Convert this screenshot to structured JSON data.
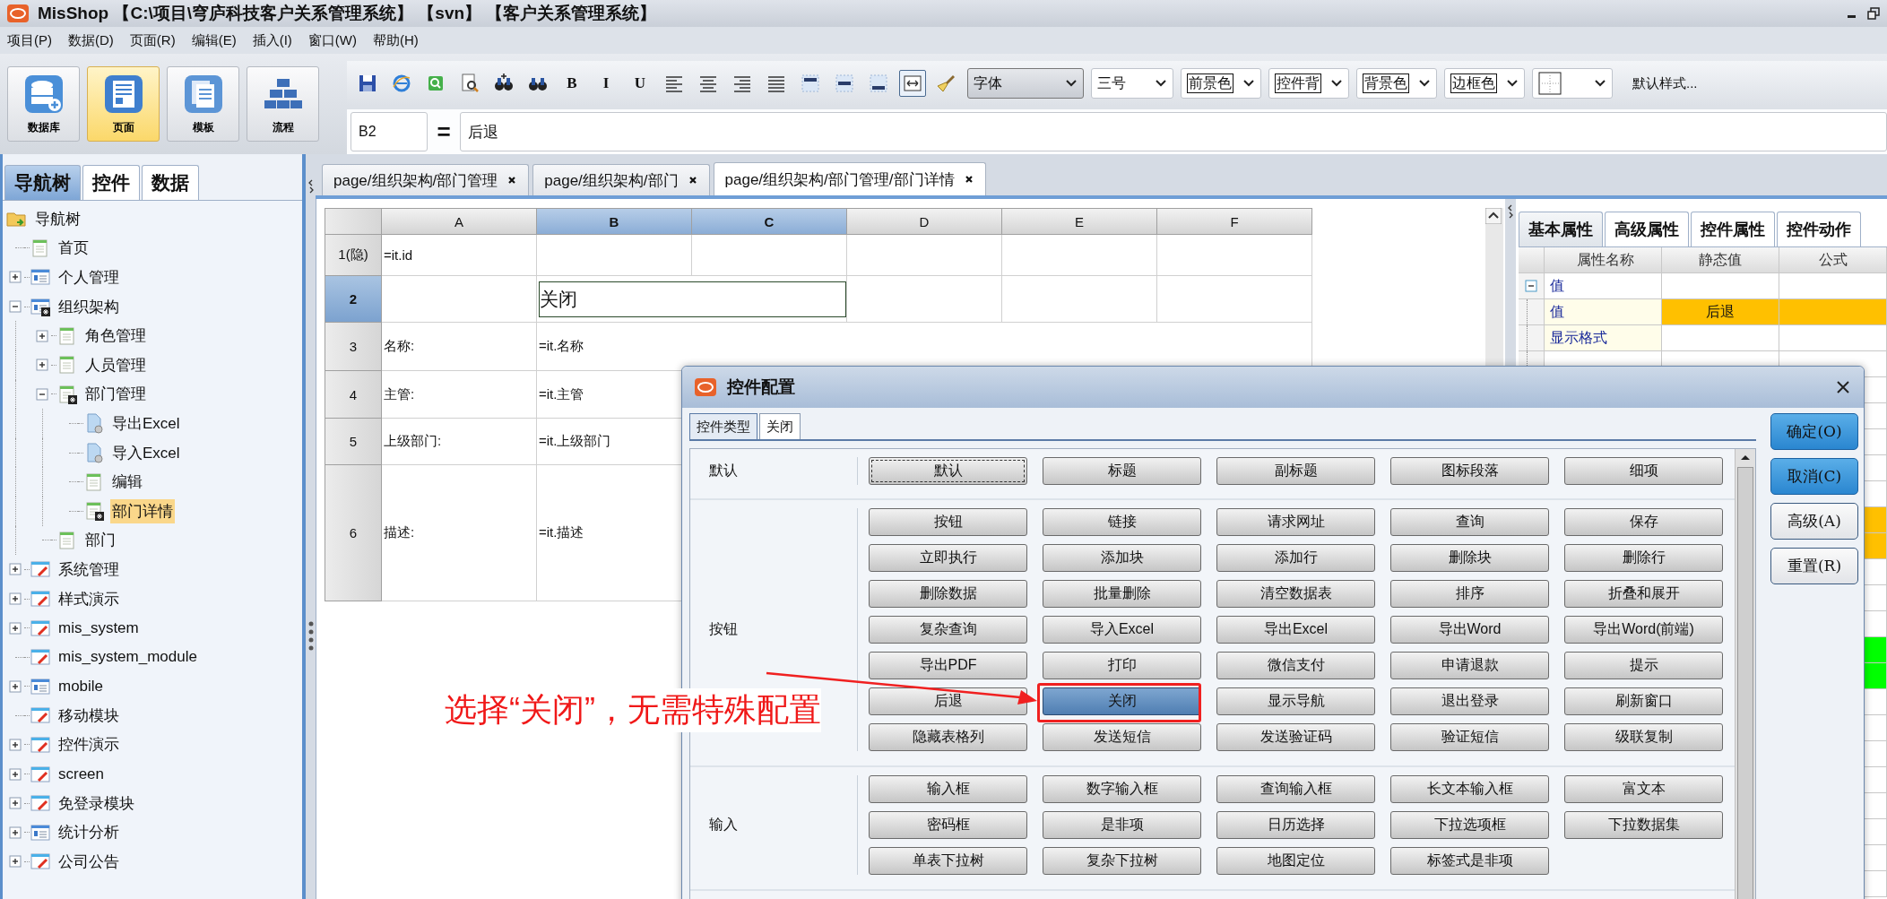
{
  "window": {
    "title": "MisShop 【C:\\项目\\穹庐科技客户关系管理系统】 【svn】 【客户关系管理系统】"
  },
  "menu": [
    "项目(P)",
    "数据(D)",
    "页面(R)",
    "编辑(E)",
    "插入(I)",
    "窗口(W)",
    "帮助(H)"
  ],
  "ribbon": [
    {
      "label": "数据库",
      "kind": "database",
      "selected": false
    },
    {
      "label": "页面",
      "kind": "page",
      "selected": true
    },
    {
      "label": "模板",
      "kind": "template",
      "selected": false
    },
    {
      "label": "流程",
      "kind": "flow",
      "selected": false
    }
  ],
  "toolbar": {
    "tools": [
      {
        "kind": "save",
        "selected": false
      },
      {
        "kind": "browser",
        "selected": false
      },
      {
        "kind": "find",
        "selected": false
      },
      {
        "kind": "preview",
        "selected": false
      },
      {
        "kind": "binoculars_plus",
        "selected": false
      },
      {
        "kind": "binoculars",
        "selected": false
      },
      {
        "kind": "text",
        "label": "B",
        "selected": false
      },
      {
        "kind": "text",
        "label": "I",
        "selected": false
      },
      {
        "kind": "text",
        "label": "U",
        "selected": false
      },
      {
        "kind": "align_left",
        "selected": false
      },
      {
        "kind": "align_center",
        "selected": false
      },
      {
        "kind": "align_right",
        "selected": false
      },
      {
        "kind": "justify",
        "selected": false
      },
      {
        "kind": "valign_top",
        "selected": false
      },
      {
        "kind": "valign_middle",
        "selected": false
      },
      {
        "kind": "valign_bottom",
        "selected": false
      },
      {
        "kind": "merge",
        "selected": true
      },
      {
        "kind": "brush",
        "selected": false
      }
    ],
    "selects": [
      {
        "kind": "plain",
        "value": "字体"
      },
      {
        "kind": "plain",
        "value": "三号"
      },
      {
        "kind": "framed",
        "value": "前景色"
      },
      {
        "kind": "framed",
        "value": "控件背"
      },
      {
        "kind": "framed",
        "value": "背景色"
      },
      {
        "kind": "framed",
        "value": "边框色"
      },
      {
        "kind": "border"
      }
    ],
    "style_link": "默认样式..."
  },
  "formula_bar": {
    "cell": "B2",
    "sign": "=",
    "value": "后退"
  },
  "doc_tabs": [
    {
      "label": "page/组织架构/部门管理",
      "selected": false
    },
    {
      "label": "page/组织架构/部门",
      "selected": false
    },
    {
      "label": "page/组织架构/部门管理/部门详情",
      "selected": true
    }
  ],
  "left_panel": {
    "tabs": [
      {
        "label": "导航树",
        "selected": true
      },
      {
        "label": "控件",
        "selected": false
      },
      {
        "label": "数据",
        "selected": false
      }
    ],
    "tree": {
      "label": "导航树",
      "kind": "folder",
      "selected": false,
      "children": [
        {
          "label": "首页",
          "kind": "page",
          "selected": false
        },
        {
          "label": "个人管理",
          "kind": "list",
          "selected": false,
          "expanded": false
        },
        {
          "label": "组织架构",
          "kind": "list_marked",
          "selected": false,
          "expanded": true,
          "children": [
            {
              "label": "角色管理",
              "kind": "page",
              "selected": false,
              "expanded": false
            },
            {
              "label": "人员管理",
              "kind": "page",
              "selected": false,
              "expanded": false
            },
            {
              "label": "部门管理",
              "kind": "page_marked",
              "selected": false,
              "expanded": true,
              "children": [
                {
                  "label": "导出Excel",
                  "kind": "action",
                  "selected": false
                },
                {
                  "label": "导入Excel",
                  "kind": "action",
                  "selected": false
                },
                {
                  "label": "编辑",
                  "kind": "page",
                  "selected": false
                },
                {
                  "label": "部门详情",
                  "kind": "page_marked",
                  "selected": true
                }
              ]
            },
            {
              "label": "部门",
              "kind": "page",
              "selected": false
            }
          ]
        },
        {
          "label": "系统管理",
          "kind": "module",
          "selected": false,
          "expanded": false
        },
        {
          "label": "样式演示",
          "kind": "module",
          "selected": false,
          "expanded": false
        },
        {
          "label": "mis_system",
          "kind": "module",
          "selected": false,
          "expanded": false
        },
        {
          "label": "mis_system_module",
          "kind": "module",
          "selected": false
        },
        {
          "label": "mobile",
          "kind": "list",
          "selected": false,
          "expanded": false
        },
        {
          "label": "移动模块",
          "kind": "module",
          "selected": false
        },
        {
          "label": "控件演示",
          "kind": "module",
          "selected": false,
          "expanded": false
        },
        {
          "label": "screen",
          "kind": "module",
          "selected": false,
          "expanded": false
        },
        {
          "label": "免登录模块",
          "kind": "module",
          "selected": false,
          "expanded": false
        },
        {
          "label": "统计分析",
          "kind": "list",
          "selected": false,
          "expanded": false
        },
        {
          "label": "公司公告",
          "kind": "module",
          "selected": false,
          "expanded": false
        }
      ]
    }
  },
  "sheet": {
    "columns": [
      {
        "label": "A",
        "selected": false
      },
      {
        "label": "B",
        "selected": true
      },
      {
        "label": "C",
        "selected": true
      },
      {
        "label": "D",
        "selected": false
      },
      {
        "label": "E",
        "selected": false
      },
      {
        "label": "F",
        "selected": false
      }
    ],
    "rows": [
      {
        "header": "1(隐)",
        "selected": false,
        "kind": "plain",
        "cells": [
          "=it.id"
        ]
      },
      {
        "header": "2",
        "selected": true,
        "kind": "merged_bc",
        "cells": [
          "",
          "关闭"
        ]
      },
      {
        "header": "3",
        "selected": false,
        "kind": "merged_bf",
        "cells": [
          "名称:",
          "=it.名称"
        ]
      },
      {
        "header": "4",
        "selected": false,
        "kind": "merged_bf",
        "cells": [
          "主管:",
          "=it.主管"
        ]
      },
      {
        "header": "5",
        "selected": false,
        "kind": "merged_bf",
        "cells": [
          "上级部门:",
          "=it.上级部门"
        ]
      },
      {
        "header": "6",
        "selected": false,
        "kind": "merged_bf",
        "cells": [
          "描述:",
          "=it.描述"
        ]
      }
    ]
  },
  "properties": {
    "tabs": [
      {
        "label": "基本属性",
        "selected": true
      },
      {
        "label": "高级属性",
        "selected": false
      },
      {
        "label": "控件属性",
        "selected": false
      },
      {
        "label": "控件动作",
        "selected": false
      }
    ],
    "columns": [
      "属性名称",
      "静态值",
      "公式"
    ],
    "rows": [
      {
        "kind": "group",
        "name": "值",
        "expanded": true
      },
      {
        "kind": "item",
        "name": "值",
        "value": "后退",
        "color": "#ffc000"
      },
      {
        "kind": "item",
        "name": "显示格式"
      },
      {
        "kind": "item"
      },
      {
        "kind": "item"
      },
      {
        "kind": "item"
      },
      {
        "kind": "item"
      },
      {
        "kind": "item"
      },
      {
        "kind": "item"
      },
      {
        "kind": "item",
        "color": "#ffc000"
      },
      {
        "kind": "item",
        "color": "#ffc000"
      },
      {
        "kind": "item"
      },
      {
        "kind": "item"
      },
      {
        "kind": "item"
      },
      {
        "kind": "item",
        "color": "#00ff00"
      },
      {
        "kind": "item",
        "color": "#00ff00"
      },
      {
        "kind": "item"
      },
      {
        "kind": "item"
      },
      {
        "kind": "item"
      },
      {
        "kind": "item"
      },
      {
        "kind": "item"
      },
      {
        "kind": "item"
      },
      {
        "kind": "item"
      },
      {
        "kind": "item"
      }
    ]
  },
  "dialog": {
    "title": "控件配置",
    "tabs": [
      {
        "label": "控件类型",
        "selected": true
      },
      {
        "label": "关闭",
        "selected": false
      }
    ],
    "sections": [
      {
        "label": "默认",
        "buttons": [
          {
            "label": "默认",
            "selected": false,
            "focused": true
          },
          {
            "label": "标题",
            "selected": false,
            "focused": false
          },
          {
            "label": "副标题",
            "selected": false,
            "focused": false
          },
          {
            "label": "图标段落",
            "selected": false,
            "focused": false
          },
          {
            "label": "细项",
            "selected": false,
            "focused": false
          }
        ]
      },
      {
        "label": "按钮",
        "buttons": [
          {
            "label": "按钮",
            "selected": false,
            "focused": false
          },
          {
            "label": "链接",
            "selected": false,
            "focused": false
          },
          {
            "label": "请求网址",
            "selected": false,
            "focused": false
          },
          {
            "label": "查询",
            "selected": false,
            "focused": false
          },
          {
            "label": "保存",
            "selected": false,
            "focused": false
          },
          {
            "label": "立即执行",
            "selected": false,
            "focused": false
          },
          {
            "label": "添加块",
            "selected": false,
            "focused": false
          },
          {
            "label": "添加行",
            "selected": false,
            "focused": false
          },
          {
            "label": "删除块",
            "selected": false,
            "focused": false
          },
          {
            "label": "删除行",
            "selected": false,
            "focused": false
          },
          {
            "label": "删除数据",
            "selected": false,
            "focused": false
          },
          {
            "label": "批量删除",
            "selected": false,
            "focused": false
          },
          {
            "label": "清空数据表",
            "selected": false,
            "focused": false
          },
          {
            "label": "排序",
            "selected": false,
            "focused": false
          },
          {
            "label": "折叠和展开",
            "selected": false,
            "focused": false
          },
          {
            "label": "复杂查询",
            "selected": false,
            "focused": false
          },
          {
            "label": "导入Excel",
            "selected": false,
            "focused": false
          },
          {
            "label": "导出Excel",
            "selected": false,
            "focused": false
          },
          {
            "label": "导出Word",
            "selected": false,
            "focused": false
          },
          {
            "label": "导出Word(前端)",
            "selected": false,
            "focused": false
          },
          {
            "label": "导出PDF",
            "selected": false,
            "focused": false
          },
          {
            "label": "打印",
            "selected": false,
            "focused": false
          },
          {
            "label": "微信支付",
            "selected": false,
            "focused": false
          },
          {
            "label": "申请退款",
            "selected": false,
            "focused": false
          },
          {
            "label": "提示",
            "selected": false,
            "focused": false
          },
          {
            "label": "后退",
            "selected": false,
            "focused": false
          },
          {
            "label": "关闭",
            "selected": true,
            "focused": false
          },
          {
            "label": "显示导航",
            "selected": false,
            "focused": false
          },
          {
            "label": "退出登录",
            "selected": false,
            "focused": false
          },
          {
            "label": "刷新窗口",
            "selected": false,
            "focused": false
          },
          {
            "label": "隐藏表格列",
            "selected": false,
            "focused": false
          },
          {
            "label": "发送短信",
            "selected": false,
            "focused": false
          },
          {
            "label": "发送验证码",
            "selected": false,
            "focused": false
          },
          {
            "label": "验证短信",
            "selected": false,
            "focused": false
          },
          {
            "label": "级联复制",
            "selected": false,
            "focused": false
          }
        ]
      },
      {
        "label": "输入",
        "buttons": [
          {
            "label": "输入框",
            "selected": false,
            "focused": false
          },
          {
            "label": "数字输入框",
            "selected": false,
            "focused": false
          },
          {
            "label": "查询输入框",
            "selected": false,
            "focused": false
          },
          {
            "label": "长文本输入框",
            "selected": false,
            "focused": false
          },
          {
            "label": "富文本",
            "selected": false,
            "focused": false
          },
          {
            "label": "密码框",
            "selected": false,
            "focused": false
          },
          {
            "label": "是非项",
            "selected": false,
            "focused": false
          },
          {
            "label": "日历选择",
            "selected": false,
            "focused": false
          },
          {
            "label": "下拉选项框",
            "selected": false,
            "focused": false
          },
          {
            "label": "下拉数据集",
            "selected": false,
            "focused": false
          },
          {
            "label": "单表下拉树",
            "selected": false,
            "focused": false
          },
          {
            "label": "复杂下拉树",
            "selected": false,
            "focused": false
          },
          {
            "label": "地图定位",
            "selected": false,
            "focused": false
          },
          {
            "label": "标签式是非项",
            "selected": false,
            "focused": false
          }
        ]
      }
    ],
    "actions": [
      {
        "label": "确定(O)",
        "kind": "primary"
      },
      {
        "label": "取消(C)",
        "kind": "primary"
      },
      {
        "label": "高级(A)",
        "kind": "normal"
      },
      {
        "label": "重置(R)",
        "kind": "normal"
      }
    ]
  },
  "annotation": {
    "text": "选择“关闭”，无需特殊配置"
  }
}
